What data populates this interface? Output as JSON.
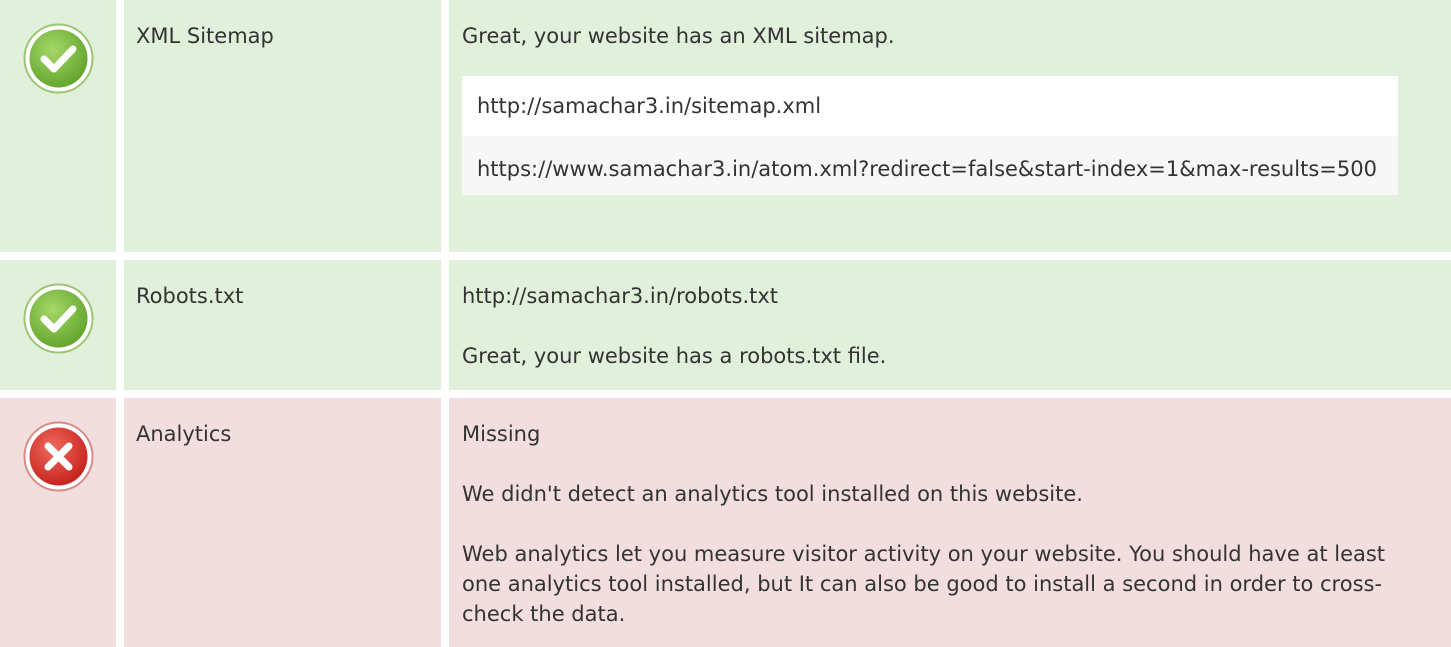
{
  "rows": [
    {
      "status": "ok",
      "icon": "check-circle-icon",
      "name": "XML Sitemap",
      "message": "Great, your website has an XML sitemap.",
      "urls": [
        "http://samachar3.in/sitemap.xml",
        "https://www.samachar3.in/atom.xml?redirect=false&start-index=1&max-results=500"
      ]
    },
    {
      "status": "ok",
      "icon": "check-circle-icon",
      "name": "Robots.txt",
      "lines": [
        "http://samachar3.in/robots.txt",
        "Great, your website has a robots.txt file."
      ]
    },
    {
      "status": "bad",
      "icon": "error-circle-icon",
      "name": "Analytics",
      "lines": [
        "Missing",
        "We didn't detect an analytics tool installed on this website.",
        "Web analytics let you measure visitor activity on your website. You should have at least one analytics tool installed, but It can also be good to install a second in order to cross-check the data."
      ]
    }
  ],
  "colors": {
    "ok_bg": "#e1f0da",
    "bad_bg": "#f2dede",
    "ok_icon": "#7bbf3a",
    "bad_icon": "#d7302b"
  }
}
